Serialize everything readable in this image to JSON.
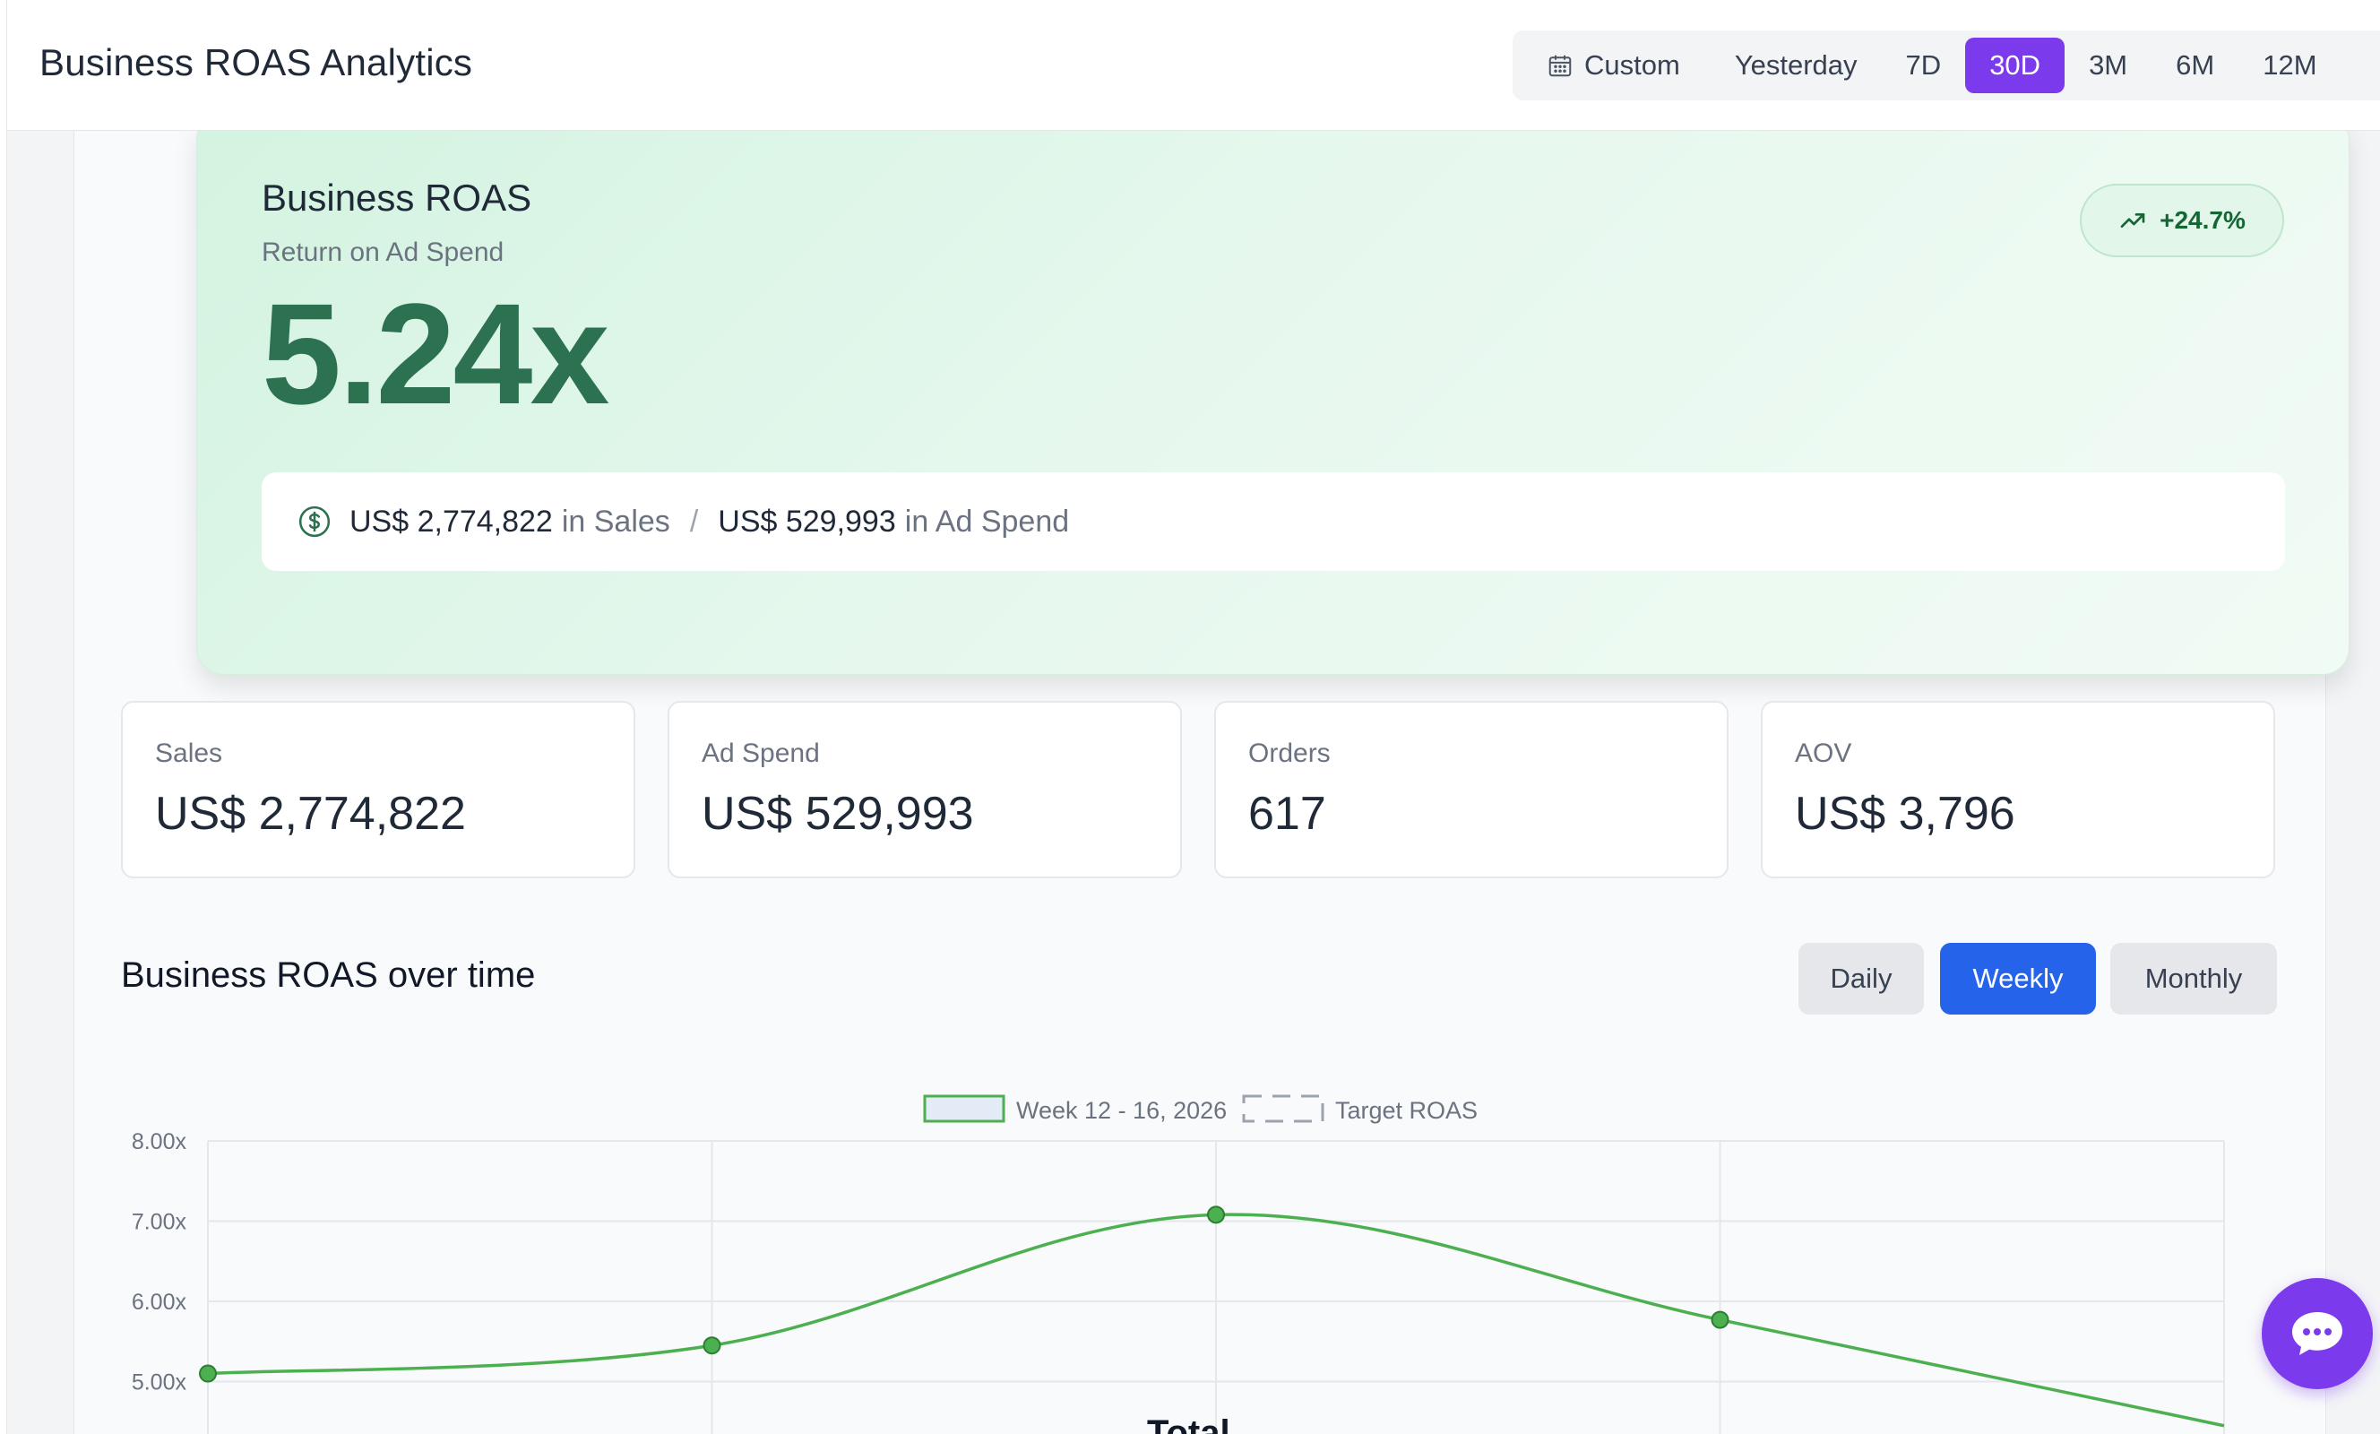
{
  "header": {
    "title": "Business ROAS Analytics",
    "ranges": [
      {
        "label": "Custom",
        "active": false
      },
      {
        "label": "Yesterday",
        "active": false
      },
      {
        "label": "7D",
        "active": false
      },
      {
        "label": "30D",
        "active": true
      },
      {
        "label": "3M",
        "active": false
      },
      {
        "label": "6M",
        "active": false
      },
      {
        "label": "12M",
        "active": false
      }
    ],
    "accent_color": "#7c3aed"
  },
  "hero": {
    "title": "Business ROAS",
    "subtitle": "Return on Ad Spend",
    "change": "+24.7%",
    "value": "5.24x",
    "sales_amount": "US$ 2,774,822",
    "sales_suffix": "in Sales",
    "separator": "/",
    "spend_amount": "US$ 529,993",
    "spend_suffix": "in Ad Spend",
    "value_color": "#2d7250"
  },
  "stats": [
    {
      "label": "Sales",
      "value": "US$ 2,774,822"
    },
    {
      "label": "Ad Spend",
      "value": "US$ 529,993"
    },
    {
      "label": "Orders",
      "value": "617"
    },
    {
      "label": "AOV",
      "value": "US$ 3,796"
    }
  ],
  "section": {
    "title": "Business ROAS over time",
    "granularity": [
      {
        "label": "Daily",
        "active": false
      },
      {
        "label": "Weekly",
        "active": true
      },
      {
        "label": "Monthly",
        "active": false
      }
    ]
  },
  "chart_data": {
    "type": "line",
    "legend": [
      "Week 12 - 16, 2026",
      "Target ROAS"
    ],
    "legend_placement": "top-center",
    "series": [
      {
        "name": "Week 12 - 16, 2026",
        "values": [
          5.1,
          5.45,
          7.08,
          5.77,
          4.45
        ],
        "color": "#4caf50"
      }
    ],
    "y_ticks": [
      "8.00x",
      "7.00x",
      "6.00x",
      "5.00x"
    ],
    "ylim": [
      5.0,
      8.0
    ],
    "grid": true,
    "partial_title": "Total"
  }
}
